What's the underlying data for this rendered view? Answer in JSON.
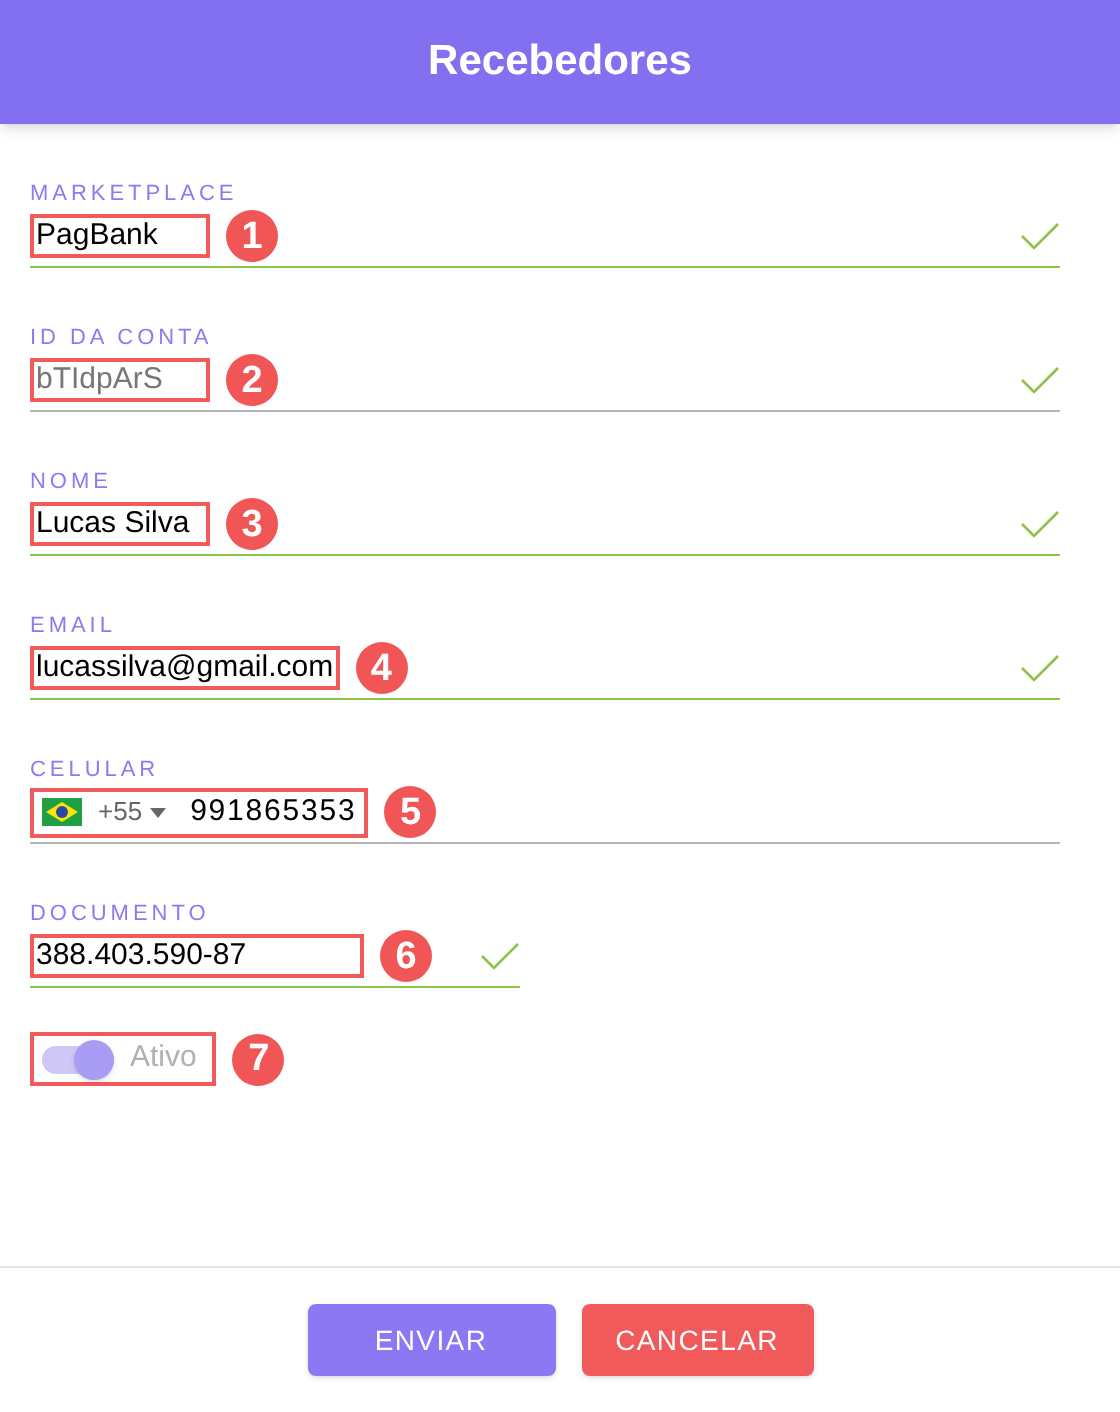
{
  "header": {
    "title": "Recebedores"
  },
  "fields": [
    {
      "kind": "text",
      "label": "MARKETPLACE",
      "value": "PagBank",
      "valid": true,
      "disabled": false,
      "annotation": "1"
    },
    {
      "kind": "text",
      "label": "ID DA CONTA",
      "value": "bTIdpArS",
      "valid": true,
      "disabled": true,
      "annotation": "2"
    },
    {
      "kind": "text",
      "label": "NOME",
      "value": "Lucas Silva",
      "valid": true,
      "disabled": false,
      "annotation": "3"
    },
    {
      "kind": "text",
      "label": "EMAIL",
      "value": "lucassilva@gmail.com",
      "valid": true,
      "disabled": false,
      "annotation": "4"
    },
    {
      "kind": "phone",
      "label": "CELULAR",
      "code": "+55",
      "value": "991865353",
      "valid": false,
      "disabled": false,
      "annotation": "5"
    },
    {
      "kind": "short",
      "label": "DOCUMENTO",
      "value": "388.403.590-87",
      "valid": true,
      "disabled": false,
      "annotation": "6"
    },
    {
      "kind": "toggle",
      "label": "Ativo",
      "on": true,
      "annotation": "7"
    }
  ],
  "buttons": [
    {
      "kind": "primary",
      "label": "ENVIAR"
    },
    {
      "kind": "danger",
      "label": "CANCELAR"
    }
  ]
}
